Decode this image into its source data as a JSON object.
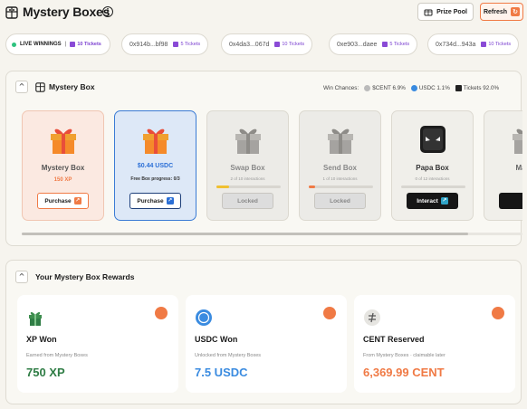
{
  "header": {
    "title": "Mystery Boxes",
    "info_icon": "info-icon",
    "prize_pool_label": "Prize Pool",
    "refresh_label": "Refresh"
  },
  "ticker": {
    "live_label": "LIVE WINNINGS",
    "first_prize": "10 Tickets",
    "items": [
      {
        "address": "0x914b...bf98",
        "prize": "5 Tickets"
      },
      {
        "address": "0x4da3...067d",
        "prize": "10 Tickets"
      },
      {
        "address": "0xe903...daee",
        "prize": "5 Tickets"
      },
      {
        "address": "0x734d...943a",
        "prize": "10 Tickets"
      }
    ]
  },
  "mystery_box": {
    "title": "Mystery Box",
    "win_chances_label": "Win Chances:",
    "chances": [
      {
        "label": "$CENT 6.9%"
      },
      {
        "label": "USDC 1.1%"
      },
      {
        "label": "Tickets 92.0%"
      }
    ],
    "cards": [
      {
        "name": "Mystery Box",
        "sub": "150 XP",
        "button": "Purchase"
      },
      {
        "name": "$0.44 USDC",
        "sub": "Free Box progress: 0/3",
        "button": "Purchase"
      },
      {
        "name": "Swap Box",
        "sub": "2 of 10 interactions",
        "button": "Locked",
        "progress": 0.2
      },
      {
        "name": "Send Box",
        "sub": "1 of 10 interactions",
        "button": "Locked",
        "progress": 0.1
      },
      {
        "name": "Papa Box",
        "sub": "0 of 12 interactions",
        "button": "Interact",
        "progress": 0
      },
      {
        "name": "Make",
        "sub": "",
        "button": "In"
      }
    ],
    "colors": {
      "accent_orange": "#f07a45",
      "accent_blue": "#3a7bd5"
    }
  },
  "rewards": {
    "title": "Your Mystery Box Rewards",
    "cards": [
      {
        "title": "XP Won",
        "sub": "Earned from Mystery Boxes",
        "value": "750 XP",
        "color": "#2f7d45",
        "icon": "gift-icon"
      },
      {
        "title": "USDC Won",
        "sub": "Unlocked from Mystery Boxes",
        "value": "7.5 USDC",
        "color": "#3a8be0",
        "icon": "usdc-icon"
      },
      {
        "title": "CENT Reserved",
        "sub": "From Mystery Boxes · claimable later",
        "value": "6,369.99 CENT",
        "color": "#f07a45",
        "icon": "cent-icon"
      }
    ]
  }
}
